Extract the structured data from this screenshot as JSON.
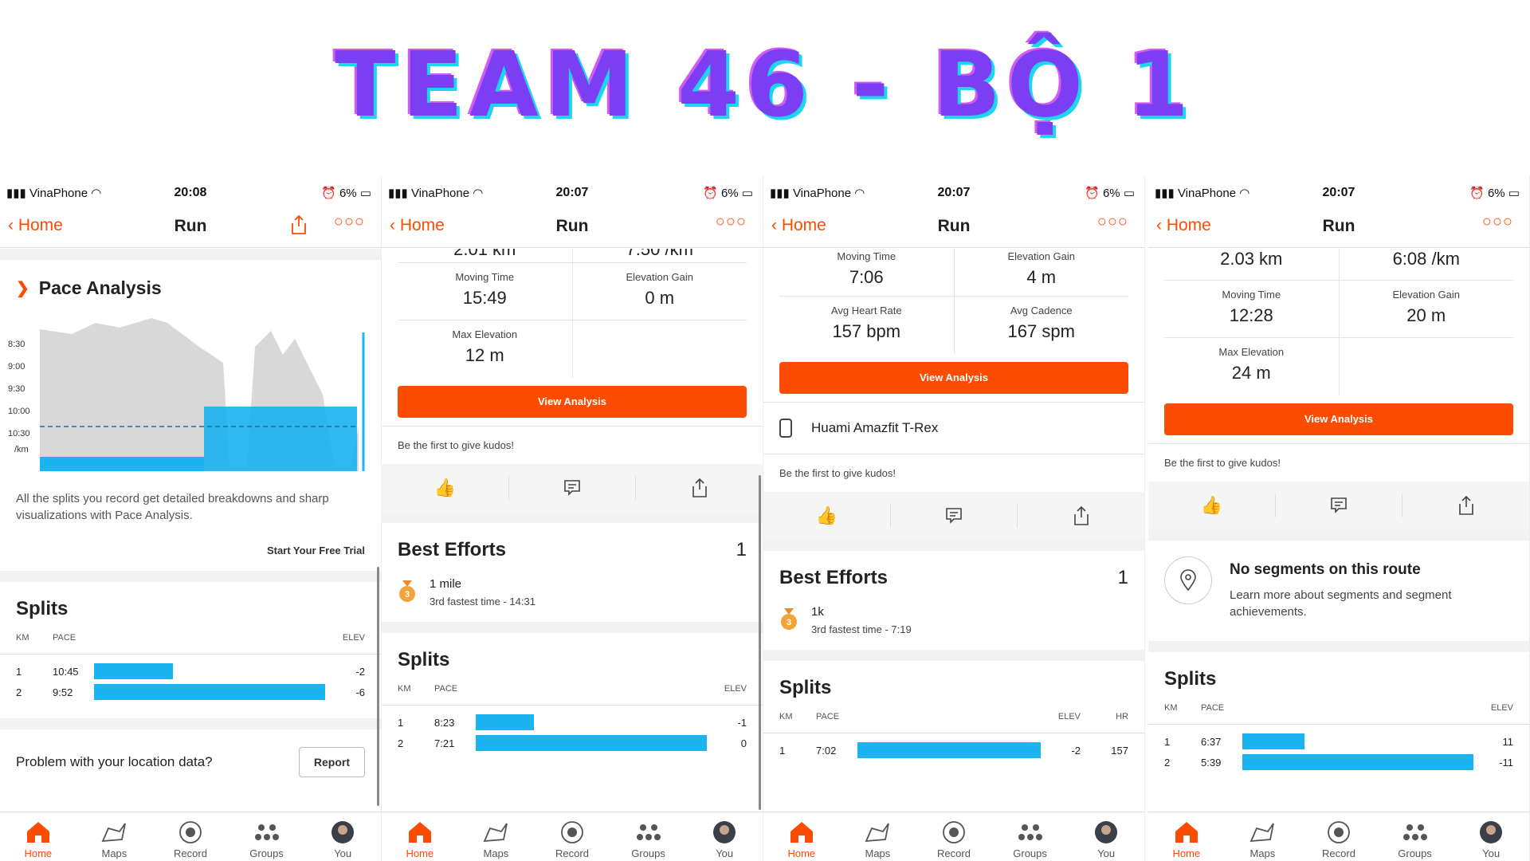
{
  "banner": {
    "title": "TEAM 46 - BỘ 1"
  },
  "colors": {
    "accent": "#fc4c02",
    "bar": "#1bb3f0",
    "banner": "#7b3ef2"
  },
  "status": {
    "carrier": "VinaPhone",
    "battery": "6%"
  },
  "nav": {
    "back": "Home",
    "title": "Run"
  },
  "tabs": [
    "Home",
    "Maps",
    "Record",
    "Groups",
    "You"
  ],
  "common": {
    "view_analysis": "View Analysis",
    "kudos": "Be the first to give kudos!",
    "splits": "Splits",
    "best_efforts": "Best Efforts",
    "km": "KM",
    "pace": "PACE",
    "elev": "ELEV",
    "hr": "HR"
  },
  "p1": {
    "time": "20:08",
    "pace_title": "Pace Analysis",
    "ylabels": [
      "8:30",
      "9:00",
      "9:30",
      "10:00",
      "10:30",
      "/km"
    ],
    "desc": "All the splits you record get detailed breakdowns and sharp visualizations with Pace Analysis.",
    "trial": "Start Your Free Trial",
    "splits": [
      {
        "km": "1",
        "pace": "10:45",
        "elev": "-2",
        "frac": 0.34
      },
      {
        "km": "2",
        "pace": "9:52",
        "elev": "-6",
        "frac": 1.0
      }
    ],
    "problem": "Problem with your location data?",
    "report": "Report"
  },
  "p2": {
    "time": "20:07",
    "top": {
      "l": "2.01 km",
      "r": "7:50 /km"
    },
    "moving_time_l": "Moving Time",
    "moving_time": "15:49",
    "elev_gain_l": "Elevation Gain",
    "elev_gain": "0 m",
    "max_elev_l": "Max Elevation",
    "max_elev": "12 m",
    "best_count": "1",
    "effort": {
      "name": "1 mile",
      "sub": "3rd fastest time - 14:31",
      "rank": "3"
    },
    "splits": [
      {
        "km": "1",
        "pace": "8:23",
        "elev": "-1",
        "frac": 0.25
      },
      {
        "km": "2",
        "pace": "7:21",
        "elev": "0",
        "frac": 1.0
      }
    ]
  },
  "p3": {
    "time": "20:07",
    "moving_time_l": "Moving Time",
    "moving_time": "7:06",
    "elev_gain_l": "Elevation Gain",
    "elev_gain": "4 m",
    "hr_l": "Avg Heart Rate",
    "hr": "157 bpm",
    "cad_l": "Avg Cadence",
    "cad": "167 spm",
    "device": "Huami Amazfit T-Rex",
    "best_count": "1",
    "effort": {
      "name": "1k",
      "sub": "3rd fastest time - 7:19",
      "rank": "3"
    },
    "splits": [
      {
        "km": "1",
        "pace": "7:02",
        "elev": "-2",
        "hr": "157",
        "frac": 1.0
      }
    ]
  },
  "p4": {
    "time": "20:07",
    "top": {
      "l": "2.03 km",
      "r": "6:08 /km"
    },
    "moving_time_l": "Moving Time",
    "moving_time": "12:28",
    "elev_gain_l": "Elevation Gain",
    "elev_gain": "20 m",
    "max_elev_l": "Max Elevation",
    "max_elev": "24 m",
    "noseg_title": "No segments on this route",
    "noseg_text": "Learn more about segments and segment achievements.",
    "splits": [
      {
        "km": "1",
        "pace": "6:37",
        "elev": "11",
        "frac": 0.27
      },
      {
        "km": "2",
        "pace": "5:39",
        "elev": "-11",
        "frac": 1.0
      }
    ]
  }
}
